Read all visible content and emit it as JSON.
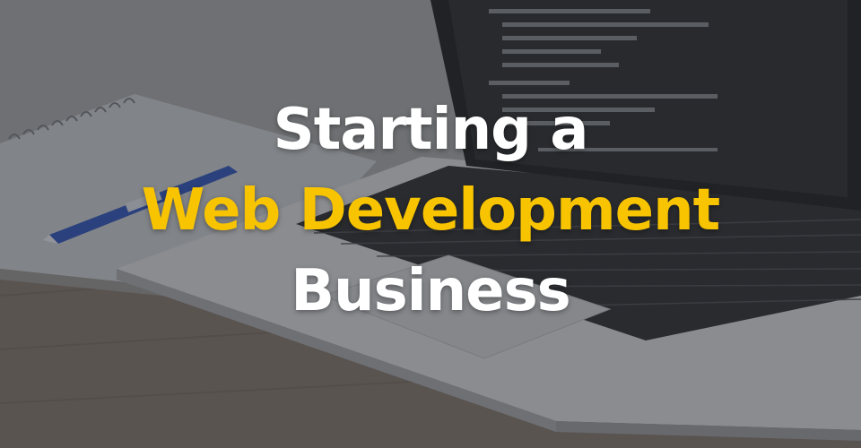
{
  "hero": {
    "headline": {
      "line1": "Starting a",
      "line2": "Web Development",
      "line3": "Business"
    },
    "colors": {
      "primary_text": "#ffffff",
      "accent_text": "#f8c400",
      "overlay": "rgba(40,42,48,0.38)"
    },
    "scene": {
      "objects": [
        "laptop-with-code-editor",
        "spiral-notebook",
        "blue-pen",
        "wooden-desk"
      ]
    }
  }
}
